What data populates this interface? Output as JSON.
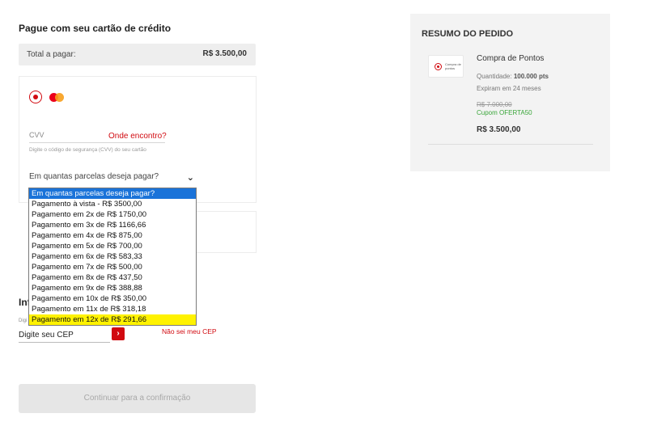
{
  "payment": {
    "title": "Pague com seu cartão de crédito",
    "total_label": "Total a pagar:",
    "total_value": "R$ 3.500,00",
    "cvv_label": "CVV",
    "cvv_help_link": "Onde encontro?",
    "cvv_hint": "Digite o código de segurança (CVV) do seu cartão",
    "installments_placeholder": "Em quantas parcelas deseja pagar?",
    "chevron_glyph": "⌄"
  },
  "installments_dropdown": {
    "options": [
      "Em quantas parcelas deseja pagar?",
      "Pagamento à vista - R$ 3500,00",
      "Pagamento em 2x de R$ 1750,00",
      "Pagamento em 3x de R$ 1166,66",
      "Pagamento em 4x de R$ 875,00",
      "Pagamento em 5x de R$ 700,00",
      "Pagamento em 6x de R$ 583,33",
      "Pagamento em 7x de R$ 500,00",
      "Pagamento em 8x de R$ 437,50",
      "Pagamento em 9x de R$ 388,88",
      "Pagamento em 10x de R$ 350,00",
      "Pagamento em 11x de R$ 318,18",
      "Pagamento em 12x de R$ 291,66"
    ],
    "selected_index": 0,
    "highlighted_index": 12
  },
  "address": {
    "title_partial": "Inf",
    "cep_micro_label": "Digi",
    "cep_placeholder": "Digite seu CEP",
    "cep_go_glyph": "›",
    "dont_know_cep": "Não sei meu CEP"
  },
  "continue_button": "Continuar para a confirmação",
  "summary": {
    "title": "RESUMO DO PEDIDO",
    "thumb_text": "Compra de pontos",
    "product_name": "Compra de Pontos",
    "quantity_label": "Quantidade:",
    "quantity_value": "100.000 pts",
    "expira": "Expiram em 24 meses",
    "old_price": "R$ 7.000,00",
    "coupon": "Cupom OFERTA50",
    "final_price": "R$ 3.500,00"
  },
  "colors": {
    "accent": "#d10a10",
    "selected_option": "#1a73d9",
    "highlight": "#fff200",
    "coupon_green": "#3aa63a"
  }
}
